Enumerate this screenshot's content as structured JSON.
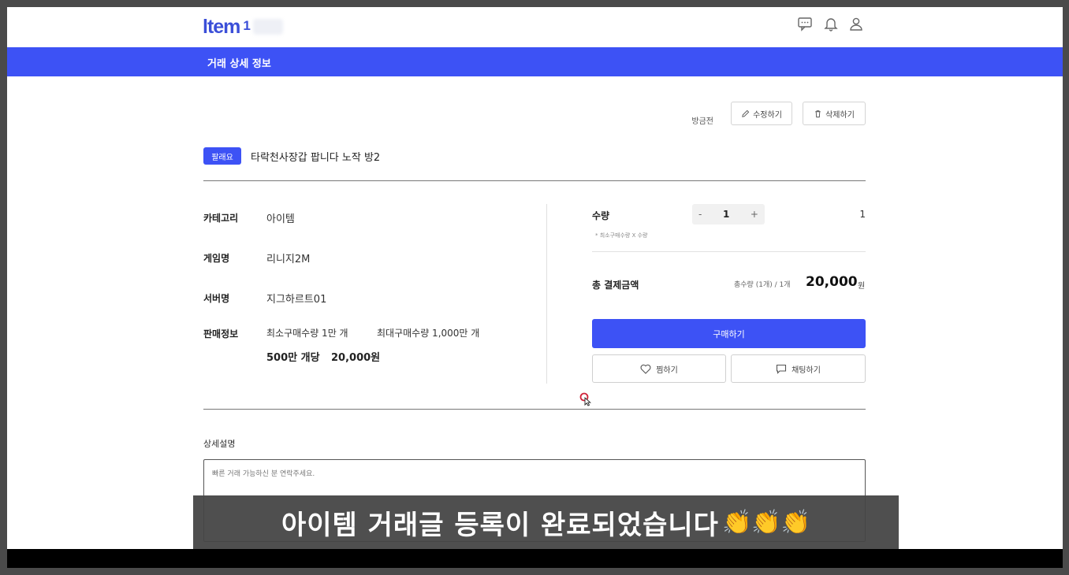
{
  "header": {
    "logo_text": "Item",
    "logo_text_display": "ltem",
    "logo_sub": "1"
  },
  "bluebar": {
    "title": "거래 상세 정보"
  },
  "actions": {
    "status": "방금전",
    "edit_label": "수정하기",
    "delete_label": "삭제하기"
  },
  "post": {
    "badge": "팔래요",
    "title": "타락천사장갑 팝니다 노작 방2"
  },
  "info": {
    "category_label": "카테고리",
    "category_value": "아이템",
    "game_label": "게임명",
    "game_value": "리니지2M",
    "server_label": "서버명",
    "server_value": "지그하르트01",
    "sale_label": "판매정보",
    "sale_min": "최소구매수량 1만 개",
    "sale_max": "최대구매수량 1,000만 개",
    "sale_unit": "500만 개당",
    "sale_price": "20,000원"
  },
  "order": {
    "qty_label": "수량",
    "qty_minus": "-",
    "qty_value": "1",
    "qty_plus": "+",
    "qty_right": "1",
    "qty_note": "* 최소구매수량 X 수량",
    "total_label": "총 결제금액",
    "total_sub": "총수량 (1개) / 1개",
    "total_amount": "20,000",
    "total_won": "원",
    "buy_label": "구매하기",
    "like_label": "찜하기",
    "chat_label": "채팅하기"
  },
  "description": {
    "label": "상세설명",
    "text": "빠른 거래 가능하신 분 연락주세요."
  },
  "caption": {
    "text": "아이템 거래글 등록이 완료되었습니다",
    "emoji": "👏👏👏"
  },
  "colors": {
    "primary": "#3d52f5",
    "logo": "#3b4fd8"
  }
}
